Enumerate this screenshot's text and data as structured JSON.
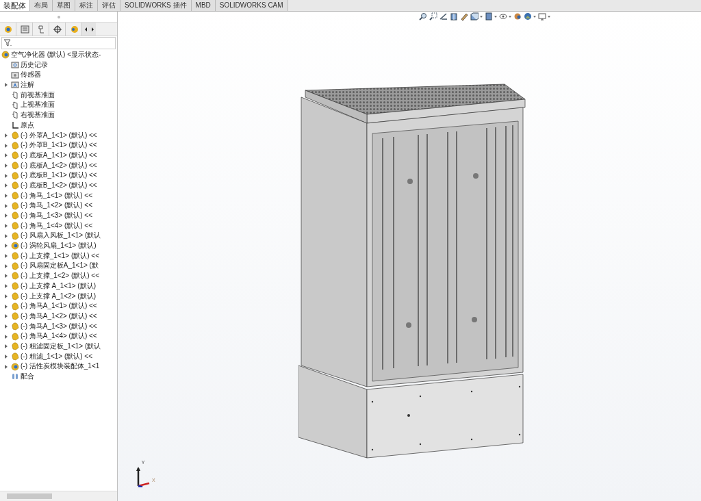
{
  "command_tabs": [
    {
      "label": "装配体",
      "selected": true
    },
    {
      "label": "布局",
      "selected": false
    },
    {
      "label": "草图",
      "selected": false
    },
    {
      "label": "标注",
      "selected": false
    },
    {
      "label": "评估",
      "selected": false
    },
    {
      "label": "SOLIDWORKS 插件",
      "selected": false
    },
    {
      "label": "MBD",
      "selected": false
    },
    {
      "label": "SOLIDWORKS CAM",
      "selected": false
    }
  ],
  "feature_tree": {
    "root": "空气净化器 (默认) <显示状态-",
    "items": [
      {
        "kind": "history",
        "label": "历史记录"
      },
      {
        "kind": "sensor",
        "label": "传感器"
      },
      {
        "kind": "annotation",
        "label": "注解"
      },
      {
        "kind": "plane",
        "label": "前视基准面"
      },
      {
        "kind": "plane",
        "label": "上视基准面"
      },
      {
        "kind": "plane",
        "label": "右视基准面"
      },
      {
        "kind": "origin",
        "label": "原点"
      },
      {
        "kind": "part",
        "label": "(-) 外罩A_1<1> (默认) <<"
      },
      {
        "kind": "part",
        "label": "(-) 外罩B_1<1> (默认) <<"
      },
      {
        "kind": "part",
        "label": "(-) 底板A_1<1> (默认) <<"
      },
      {
        "kind": "part",
        "label": "(-) 底板A_1<2> (默认) <<"
      },
      {
        "kind": "part",
        "label": "(-) 底板B_1<1> (默认) <<"
      },
      {
        "kind": "part",
        "label": "(-) 底板B_1<2> (默认) <<"
      },
      {
        "kind": "part",
        "label": "(-) 角马_1<1> (默认) <<"
      },
      {
        "kind": "part",
        "label": "(-) 角马_1<2> (默认) <<"
      },
      {
        "kind": "part",
        "label": "(-) 角马_1<3> (默认) <<"
      },
      {
        "kind": "part",
        "label": "(-) 角马_1<4> (默认) <<"
      },
      {
        "kind": "part",
        "label": "(-) 风扇入风板_1<1> (默认"
      },
      {
        "kind": "assembly",
        "label": "(-) 涡轮风扇_1<1> (默认)"
      },
      {
        "kind": "part",
        "label": "(-) 上支撑_1<1> (默认) <<"
      },
      {
        "kind": "part",
        "label": "(-) 风扇固定板A_1<1> (默"
      },
      {
        "kind": "part",
        "label": "(-) 上支撑_1<2> (默认) <<"
      },
      {
        "kind": "part",
        "label": "(-) 上支撑 A_1<1> (默认)"
      },
      {
        "kind": "part",
        "label": "(-) 上支撑 A_1<2> (默认)"
      },
      {
        "kind": "part",
        "label": "(-) 角马A_1<1> (默认) <<"
      },
      {
        "kind": "part",
        "label": "(-) 角马A_1<2> (默认) <<"
      },
      {
        "kind": "part",
        "label": "(-) 角马A_1<3> (默认) <<"
      },
      {
        "kind": "part",
        "label": "(-) 角马A_1<4> (默认) <<"
      },
      {
        "kind": "part",
        "label": "(-) 粗滤固定板_1<1> (默认"
      },
      {
        "kind": "part",
        "label": "(-) 粗滤_1<1> (默认) <<"
      },
      {
        "kind": "assembly",
        "label": "(-) 活性炭模块装配体_1<1"
      },
      {
        "kind": "mates",
        "label": "配合"
      }
    ]
  },
  "triad": {
    "y_label": "Y",
    "x_label": "X"
  }
}
